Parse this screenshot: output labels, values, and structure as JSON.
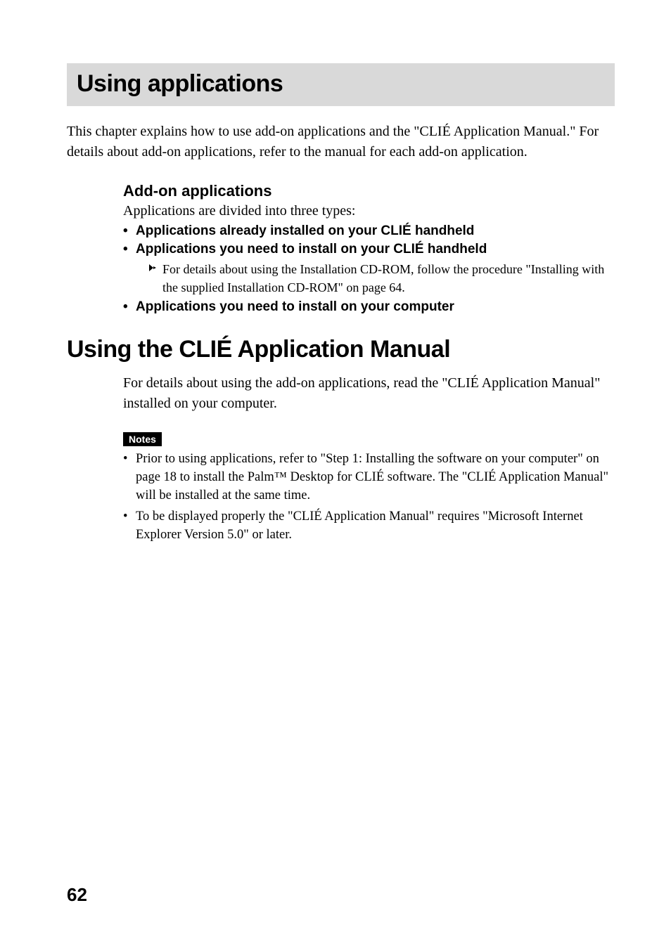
{
  "title": "Using applications",
  "intro": "This chapter explains how to use add-on applications and the \"CLIÉ Application Manual.\" For details about add-on applications, refer to the manual for each add-on application.",
  "addon": {
    "heading": "Add-on applications",
    "desc": "Applications are divided into three types:",
    "item1": "Applications already installed on your CLIÉ handheld",
    "item2": "Applications you need to install on your CLIÉ handheld",
    "item2_note": "For details about using the Installation CD-ROM, follow the procedure \"Installing with the supplied Installation CD-ROM\" on page 64.",
    "item3": "Applications you need to install on your computer"
  },
  "h2": "Using the CLIÉ Application Manual",
  "body1": "For details about using the add-on applications, read the \"CLIÉ Application Manual\" installed on your computer.",
  "notesLabel": "Notes",
  "notes": {
    "n1": "Prior to using applications, refer to \"Step 1: Installing the software on your computer\" on page 18 to install the Palm™ Desktop for CLIÉ software. The \"CLIÉ Application Manual\" will be installed at the same time.",
    "n2": "To be displayed properly the \"CLIÉ Application Manual\" requires \"Microsoft Internet Explorer Version 5.0\" or later."
  },
  "pageNumber": "62"
}
